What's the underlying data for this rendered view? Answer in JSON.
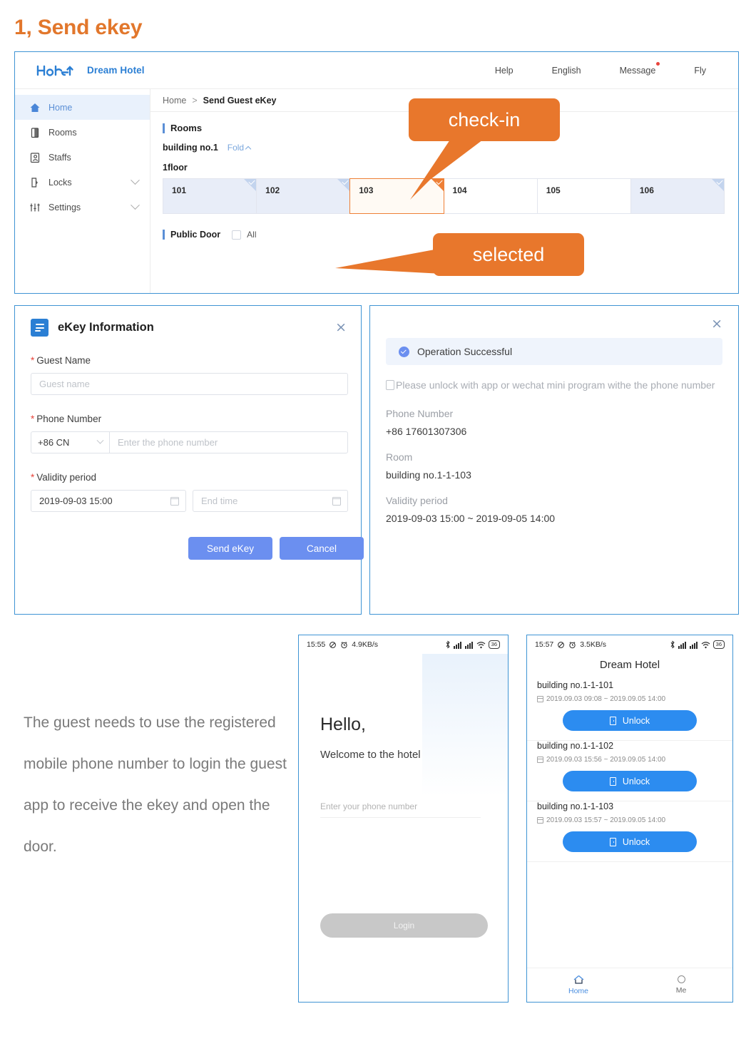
{
  "section": {
    "title": "1, Send ekey"
  },
  "browser": {
    "brand": {
      "logo": "hotel-wordmark-logo",
      "name": "Dream Hotel"
    },
    "topnav": [
      {
        "label": "Help",
        "badge": false
      },
      {
        "label": "English",
        "badge": false
      },
      {
        "label": "Message",
        "badge": true
      },
      {
        "label": "Fly",
        "badge": false
      }
    ],
    "sidebar": [
      {
        "label": "Home",
        "icon": "home-icon",
        "active": true,
        "expandable": false
      },
      {
        "label": "Rooms",
        "icon": "door-icon",
        "active": false,
        "expandable": false
      },
      {
        "label": "Staffs",
        "icon": "staff-icon",
        "active": false,
        "expandable": false
      },
      {
        "label": "Locks",
        "icon": "lock-icon",
        "active": false,
        "expandable": true
      },
      {
        "label": "Settings",
        "icon": "sliders-icon",
        "active": false,
        "expandable": true
      }
    ],
    "breadcrumb": {
      "root": "Home",
      "separator": ">",
      "current": "Send Guest eKey"
    },
    "rooms_section": {
      "heading": "Rooms",
      "building": "building no.1",
      "fold_label": "Fold",
      "floor_label": "1floor",
      "rooms": [
        {
          "no": "101",
          "state": "assigned"
        },
        {
          "no": "102",
          "state": "assigned"
        },
        {
          "no": "103",
          "state": "selected"
        },
        {
          "no": "104",
          "state": "free"
        },
        {
          "no": "105",
          "state": "free"
        },
        {
          "no": "106",
          "state": "assigned"
        }
      ]
    },
    "public_door": {
      "label": "Public Door",
      "all_label": "All",
      "checked": false
    }
  },
  "callouts": {
    "checkin": "check-in",
    "selected": "selected",
    "color": "#E8772C"
  },
  "dialog": {
    "title": "eKey Information",
    "icon": "form-icon",
    "close": "×",
    "guest_name": {
      "label": "Guest Name",
      "required": "*",
      "placeholder": "Guest name",
      "value": ""
    },
    "phone": {
      "label": "Phone Number",
      "required": "*",
      "country_code": "+86 CN",
      "placeholder": "Enter the phone number",
      "value": ""
    },
    "validity": {
      "label": "Validity period",
      "required": "*",
      "start_value": "2019-09-03 15:00",
      "end_placeholder": "End time"
    },
    "buttons": {
      "send": "Send eKey",
      "cancel": "Cancel",
      "color": "#6B8FF0"
    }
  },
  "success": {
    "close": "×",
    "banner": "Operation Successful",
    "note": "Please unlock with app or wechat mini program withe the phone number",
    "phone_label": "Phone Number",
    "phone_value": "+86 17601307306",
    "room_label": "Room",
    "room_value": "building no.1-1-103",
    "validity_label": "Validity period",
    "validity_value": "2019-09-03 15:00  ~  2019-09-05 14:00"
  },
  "paragraph": "The guest needs to use the registered mobile phone number to login the guest app to receive the ekey and open the door.",
  "phone_login": {
    "status": {
      "time": "15:55",
      "net_speed": "4.9KB/s",
      "battery": "36"
    },
    "hello": "Hello,",
    "welcome": "Welcome to the hotel",
    "input_placeholder": "Enter your phone number",
    "login_button": "Login"
  },
  "phone_keys": {
    "status": {
      "time": "15:57",
      "net_speed": "3.5KB/s",
      "battery": "36"
    },
    "title": "Dream Hotel",
    "cards": [
      {
        "name": "building no.1-1-101",
        "time": "2019.09.03 09:08 ~ 2019.09.05 14:00",
        "button": "Unlock"
      },
      {
        "name": "building no.1-1-102",
        "time": "2019.09.03 15:56 ~ 2019.09.05 14:00",
        "button": "Unlock"
      },
      {
        "name": "building no.1-1-103",
        "time": "2019.09.03 15:57 ~ 2019.09.05 14:00",
        "button": "Unlock"
      }
    ],
    "tabs": [
      {
        "label": "Home",
        "icon": "home-icon",
        "active": true
      },
      {
        "label": "Me",
        "icon": "person-icon",
        "active": false
      }
    ]
  }
}
